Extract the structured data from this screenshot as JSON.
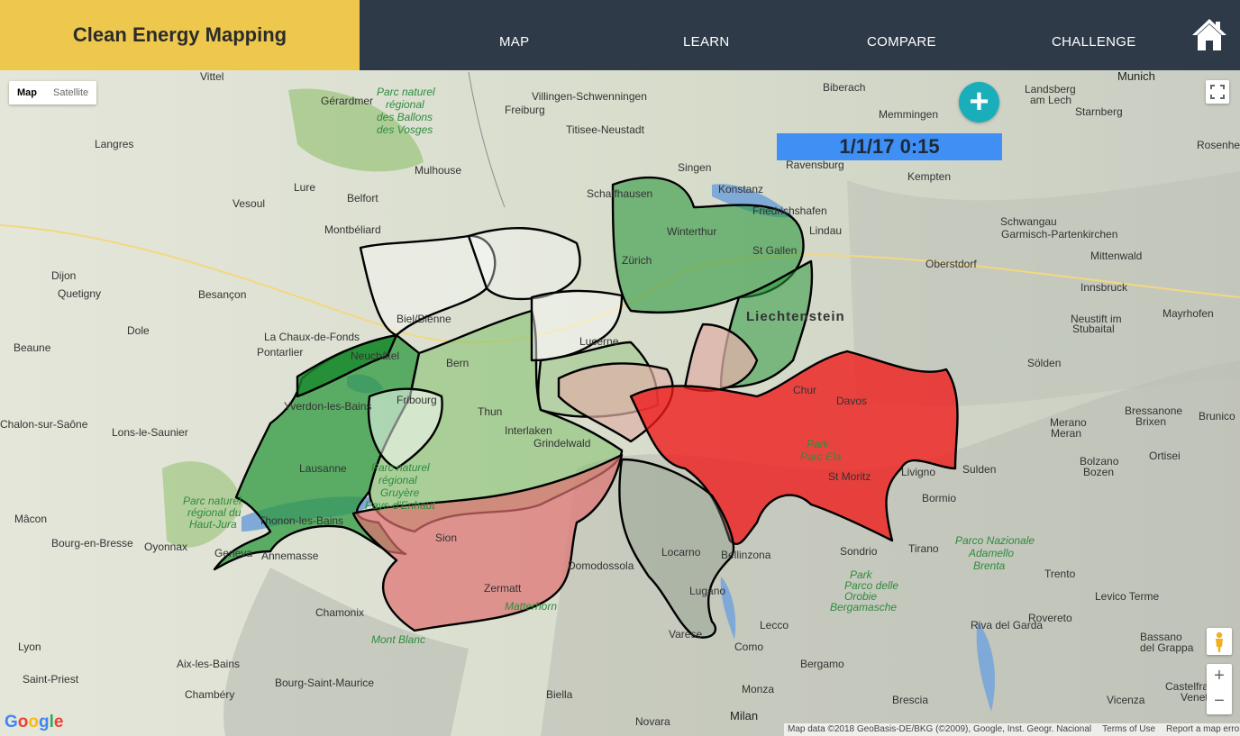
{
  "header": {
    "brand": "Clean Energy Mapping",
    "nav": [
      "MAP",
      "LEARN",
      "COMPARE",
      "CHALLENGE"
    ],
    "home_icon": "home-icon"
  },
  "map": {
    "type_control": {
      "map": "Map",
      "satellite": "Satellite"
    },
    "timestamp": "1/1/17 0:15",
    "add_icon": "plus-icon",
    "zoom": {
      "in": "+",
      "out": "−"
    },
    "logo": [
      "G",
      "o",
      "o",
      "g",
      "l",
      "e"
    ],
    "attribution": {
      "data": "Map data ©2018 GeoBasis-DE/BKG (©2009), Google, Inst. Geogr. Nacional",
      "terms": "Terms of Use",
      "report": "Report a map error"
    },
    "places": [
      [
        "Vittel",
        222,
        89
      ],
      [
        "Gérardmer",
        356,
        116
      ],
      [
        "Freiburg",
        560,
        126
      ],
      [
        "Villingen-Schwenningen",
        590,
        111
      ],
      [
        "Titisee-Neustadt",
        628,
        148
      ],
      [
        "Biberach",
        913,
        101
      ],
      [
        "Landsberg",
        1137,
        103
      ],
      [
        "am Lech",
        1143,
        115
      ],
      [
        "Munich",
        1240,
        89
      ],
      [
        "Memmingen",
        975,
        131
      ],
      [
        "Starnberg",
        1193,
        128
      ],
      [
        "Rosenheim",
        1328,
        165
      ],
      [
        "Langres",
        105,
        164
      ],
      [
        "Mulhouse",
        460,
        193
      ],
      [
        "Singen",
        752,
        190
      ],
      [
        "Ravensburg",
        872,
        187
      ],
      [
        "Kempten",
        1007,
        200
      ],
      [
        "Lure",
        326,
        212
      ],
      [
        "Schaffhausen",
        651,
        219
      ],
      [
        "Konstanz",
        797,
        214
      ],
      [
        "Friedrichshafen",
        835,
        238
      ],
      [
        "Vesoul",
        258,
        230
      ],
      [
        "Belfort",
        385,
        224
      ],
      [
        "Lindau",
        898,
        260
      ],
      [
        "Schwangau",
        1110,
        250
      ],
      [
        "Garmisch-Partenkirchen",
        1111,
        264
      ],
      [
        "Montbéliard",
        360,
        259
      ],
      [
        "Winterthur",
        740,
        261
      ],
      [
        "Mittenwald",
        1210,
        288
      ],
      [
        "Oberstdorf",
        1027,
        297
      ],
      [
        "Dijon",
        57,
        310
      ],
      [
        "Zürich",
        690,
        293
      ],
      [
        "St Gallen",
        835,
        282
      ],
      [
        "Innsbruck",
        1199,
        323
      ],
      [
        "Quetigny",
        64,
        330
      ],
      [
        "Besançon",
        220,
        331
      ],
      [
        "Liechtenstein",
        828,
        356
      ],
      [
        "Mayrhofen",
        1290,
        352
      ],
      [
        "Biel/Bienne",
        440,
        358
      ],
      [
        "Dole",
        141,
        371
      ],
      [
        "La Chaux-de-Fonds",
        293,
        378
      ],
      [
        "Neustift im",
        1188,
        358
      ],
      [
        "Stubaital",
        1190,
        369
      ],
      [
        "Lucerne",
        643,
        383
      ],
      [
        "Beaune",
        15,
        390
      ],
      [
        "Pontarlier",
        285,
        395
      ],
      [
        "Neuchâtel",
        389,
        399
      ],
      [
        "Bern",
        495,
        407
      ],
      [
        "Sölden",
        1140,
        407
      ],
      [
        "Fribourg",
        440,
        448
      ],
      [
        "Chur",
        880,
        437
      ],
      [
        "Davos",
        928,
        449
      ],
      [
        "Yverdon-les-Bains",
        315,
        455
      ],
      [
        "Thun",
        530,
        461
      ],
      [
        "Bressanone",
        1248,
        460
      ],
      [
        "Brixen",
        1260,
        472
      ],
      [
        "Brunico",
        1330,
        466
      ],
      [
        "Merano",
        1165,
        473
      ],
      [
        "Meran",
        1166,
        485
      ],
      [
        "Chalon-sur-Saône",
        0,
        475
      ],
      [
        "Lons-le-Saunier",
        124,
        484
      ],
      [
        "Interlaken",
        560,
        482
      ],
      [
        "Grindelwald",
        592,
        496
      ],
      [
        "Lausanne",
        332,
        524
      ],
      [
        "St Moritz",
        919,
        533
      ],
      [
        "Livigno",
        1000,
        528
      ],
      [
        "Bolzano",
        1198,
        516
      ],
      [
        "Bozen",
        1202,
        528
      ],
      [
        "Sulden",
        1068,
        525
      ],
      [
        "Ortisei",
        1275,
        510
      ],
      [
        "Bormio",
        1023,
        557
      ],
      [
        "Mâcon",
        16,
        580
      ],
      [
        "Thonon-les-Bains",
        287,
        582
      ],
      [
        "Sion",
        483,
        601
      ],
      [
        "Bourg-en-Bresse",
        57,
        607
      ],
      [
        "Oyonnax",
        160,
        611
      ],
      [
        "Geneva",
        238,
        618
      ],
      [
        "Annemasse",
        290,
        621
      ],
      [
        "Locarno",
        734,
        617
      ],
      [
        "Sondrio",
        932,
        616
      ],
      [
        "Tirano",
        1008,
        613
      ],
      [
        "Domodossola",
        630,
        632
      ],
      [
        "Bellinzona",
        800,
        620
      ],
      [
        "Trento",
        1159,
        641
      ],
      [
        "Lugano",
        765,
        660
      ],
      [
        "Zermatt",
        537,
        657
      ],
      [
        "Levico Terme",
        1215,
        666
      ],
      [
        "Chamonix",
        350,
        684
      ],
      [
        "Lecco",
        843,
        698
      ],
      [
        "Riva del Garda",
        1077,
        698
      ],
      [
        "Rovereto",
        1141,
        690
      ],
      [
        "Varese",
        742,
        708
      ],
      [
        "Como",
        815,
        722
      ],
      [
        "Lyon",
        20,
        722
      ],
      [
        "Bassano",
        1265,
        711
      ],
      [
        "del Grappa",
        1265,
        723
      ],
      [
        "Bergamo",
        888,
        741
      ],
      [
        "Aix-les-Bains",
        196,
        741
      ],
      [
        "Saint-Priest",
        25,
        758
      ],
      [
        "Bourg-Saint-Maurice",
        305,
        762
      ],
      [
        "Monza",
        823,
        769
      ],
      [
        "Chambéry",
        205,
        775
      ],
      [
        "Biella",
        606,
        775
      ],
      [
        "Brescia",
        990,
        781
      ],
      [
        "Vicenza",
        1228,
        781
      ],
      [
        "Castelfra",
        1293,
        766
      ],
      [
        "Veneto",
        1310,
        778
      ],
      [
        "Milan",
        810,
        799
      ],
      [
        "Novara",
        705,
        805
      ]
    ],
    "parks": [
      [
        "Parc naturel",
        418,
        106
      ],
      [
        "régional",
        428,
        120
      ],
      [
        "des Ballons",
        418,
        134
      ],
      [
        "des Vosges",
        418,
        148
      ],
      [
        "Parc naturel",
        203,
        560
      ],
      [
        "régional du",
        208,
        573
      ],
      [
        "Haut-Jura",
        210,
        586
      ],
      [
        "Parc naturel",
        412,
        523
      ],
      [
        "régional",
        420,
        537
      ],
      [
        "Gruyère",
        422,
        551
      ],
      [
        "Pays-d'Enhaut",
        405,
        565
      ],
      [
        "Parco Nazionale",
        1060,
        604
      ],
      [
        "Adamello",
        1075,
        618
      ],
      [
        "Brenta",
        1080,
        632
      ],
      [
        "Park",
        943,
        642
      ],
      [
        "Parco delle",
        937,
        654
      ],
      [
        "Orobie",
        937,
        666
      ],
      [
        "Bergamasche",
        921,
        678
      ],
      [
        "Park",
        895,
        497
      ],
      [
        "Parc Ela",
        888,
        511
      ],
      [
        "Mont Blanc",
        412,
        714
      ],
      [
        "Matterhorn",
        560,
        677
      ]
    ],
    "colors": {
      "green": "#2e9a3f",
      "darkgreen": "#188a2c",
      "red": "#f01818",
      "pink": "#e07070",
      "blush": "#e0b0a8"
    }
  }
}
